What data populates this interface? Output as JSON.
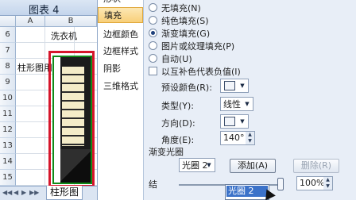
{
  "spreadsheet": {
    "window_title": "图表 4",
    "columns": [
      "A",
      "B"
    ],
    "rows": [
      "6",
      "7",
      "8",
      "9",
      "10",
      "11",
      "12",
      "13",
      "14",
      "15"
    ],
    "cell_b6": "洗衣机",
    "cell_a8": "柱形图用于",
    "sheet_tab": "柱形图"
  },
  "dialog": {
    "nav_items": [
      {
        "label": "形状",
        "selected": false
      },
      {
        "label": "填充",
        "selected": true
      },
      {
        "label": "边框颜色",
        "selected": false
      },
      {
        "label": "边框样式",
        "selected": false
      },
      {
        "label": "阴影",
        "selected": false
      },
      {
        "label": "三维格式",
        "selected": false
      }
    ],
    "fill_options": [
      {
        "label": "无填充(N)",
        "checked": false
      },
      {
        "label": "纯色填充(S)",
        "checked": false
      },
      {
        "label": "渐变填充(G)",
        "checked": true
      },
      {
        "label": "图片或纹理填充(P)",
        "checked": false
      },
      {
        "label": "自动(U)",
        "checked": false
      }
    ],
    "invert_if_negative": "以互补色代表负值(I)",
    "preset_colors_label": "预设颜色(R):",
    "type_label": "类型(Y):",
    "type_value": "线性",
    "direction_label": "方向(D):",
    "angle_label": "角度(E):",
    "angle_value": "140°",
    "gradient_stops_label": "渐变光圈",
    "stop_select_value": "光圈 2",
    "add_button": "添加(A)",
    "remove_button": "删除(R)",
    "transparency_value": "100%",
    "popup_item": "光圈 2",
    "stop_label_partial": "结"
  }
}
